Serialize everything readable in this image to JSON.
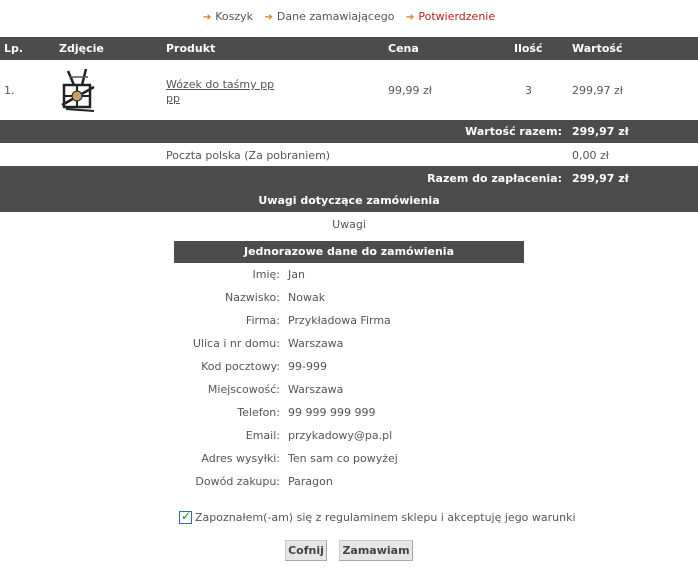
{
  "breadcrumbs": [
    {
      "label": "Koszyk",
      "active": false
    },
    {
      "label": "Dane zamawiającego",
      "active": false
    },
    {
      "label": "Potwierdzenie",
      "active": true
    }
  ],
  "table": {
    "headers": {
      "lp": "Lp.",
      "photo": "Zdjęcie",
      "product": "Produkt",
      "price": "Cena",
      "qty": "Ilość",
      "value": "Wartość"
    },
    "rows": [
      {
        "lp": "1.",
        "product_line1": "Wózek do taśmy pp",
        "product_line2": "pp",
        "price": "99,99 zł",
        "qty": "3",
        "value": "299,97 zł"
      }
    ]
  },
  "subtotal": {
    "label": "Wartość razem:",
    "value": "299,97 zł"
  },
  "shipping": {
    "method": "Poczta polska (Za pobraniem)",
    "value": "0,00 zł"
  },
  "total": {
    "label": "Razem do zapłacenia:",
    "value": "299,97 zł"
  },
  "notes": {
    "title": "Uwagi dotyczące zamówienia",
    "text": "Uwagi"
  },
  "form": {
    "title": "Jednorazowe dane do zamówienia",
    "fields": [
      {
        "label": "Imię:",
        "value": "Jan"
      },
      {
        "label": "Nazwisko:",
        "value": "Nowak"
      },
      {
        "label": "Firma:",
        "value": "Przykładowa Firma"
      },
      {
        "label": "Ulica i nr domu:",
        "value": "Warszawa"
      },
      {
        "label": "Kod pocztowy:",
        "value": "99-999"
      },
      {
        "label": "Miejscowość:",
        "value": "Warszawa"
      },
      {
        "label": "Telefon:",
        "value": "99 999 999 999"
      },
      {
        "label": "Email:",
        "value": "przykadowy@pa.pl"
      },
      {
        "label": "Adres wysyłki:",
        "value": "Ten sam co powyżej"
      },
      {
        "label": "Dowód zakupu:",
        "value": "Paragon"
      }
    ]
  },
  "terms": {
    "text": "Zapoznałem(-am) się z regulaminem sklepu i akceptuję jego warunki",
    "checked": true
  },
  "buttons": {
    "back": "Cofnij",
    "order": "Zamawiam"
  },
  "colors": {
    "header_bg": "#4c4c4c",
    "accent_orange": "#e07b1a",
    "active_red": "#b22222"
  }
}
